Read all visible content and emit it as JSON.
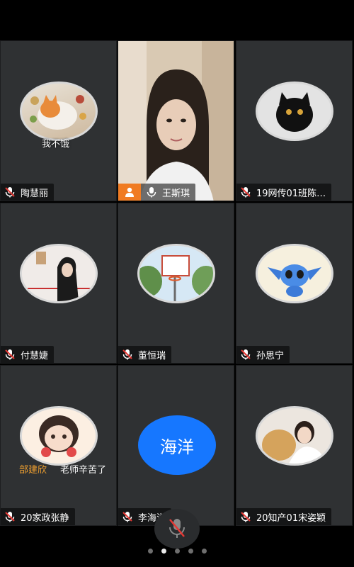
{
  "participants": [
    {
      "name": "陶慧丽",
      "caption": "我不饿"
    },
    {
      "name": "王斯琪"
    },
    {
      "name": "19网传01班陈…"
    },
    {
      "name": "付慧婕"
    },
    {
      "name": "董恒瑞"
    },
    {
      "name": "孙思宁"
    },
    {
      "name": "20家政张静",
      "caption_left": "部建欣",
      "caption_right": "老师辛苦了"
    },
    {
      "name": "李海洋",
      "avatar_text": "海洋"
    },
    {
      "name": "20知产01宋姿颖"
    }
  ],
  "pager": {
    "pages": 5,
    "active": 1
  },
  "colors": {
    "host_badge": "#f07b22",
    "avatar_blue": "#1677ff"
  }
}
